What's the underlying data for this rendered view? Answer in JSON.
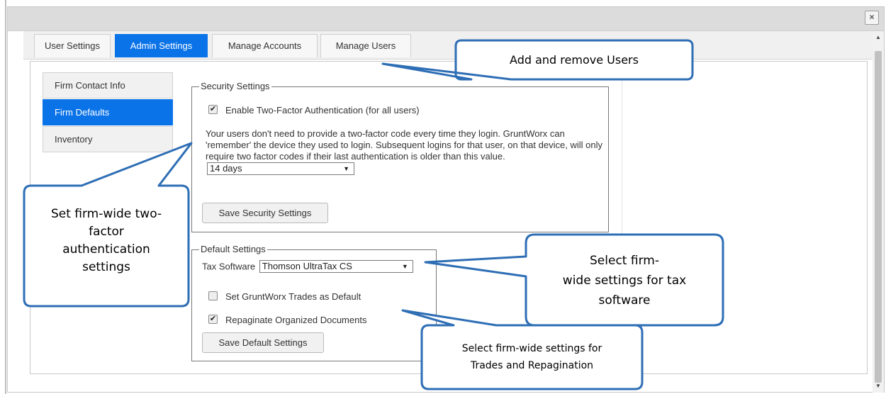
{
  "dialog": {
    "close_label": "×"
  },
  "tabs": [
    {
      "label": "User Settings",
      "active": false
    },
    {
      "label": "Admin Settings",
      "active": true
    },
    {
      "label": "Manage Accounts",
      "active": false
    },
    {
      "label": "Manage Users",
      "active": false
    }
  ],
  "side_nav": [
    {
      "label": "Firm Contact Info",
      "active": false
    },
    {
      "label": "Firm Defaults",
      "active": true
    },
    {
      "label": "Inventory",
      "active": false
    }
  ],
  "security": {
    "legend": "Security Settings",
    "two_factor_label": "Enable Two-Factor Authentication (for all users)",
    "two_factor_checked": true,
    "description": "Your users don't need to provide a two-factor code every time they login. GruntWorx can 'remember' the device they used to login. Subsequent logins for that user, on that device, will only require two factor codes if their last authentication is older than this value.",
    "remember_value": "14 days",
    "save_label": "Save Security Settings"
  },
  "defaults": {
    "legend": "Default Settings",
    "tax_software_label": "Tax Software",
    "tax_software_value": "Thomson UltraTax CS",
    "trades_label": "Set GruntWorx Trades as Default",
    "trades_checked": false,
    "repaginate_label": "Repaginate Organized Documents",
    "repaginate_checked": true,
    "save_label": "Save Default Settings"
  },
  "callouts": {
    "users": "Add and remove Users",
    "two_factor": [
      "Set firm-wide two-",
      "factor",
      "authentication",
      "settings"
    ],
    "tax": [
      "Select firm-",
      "wide settings for tax",
      "software"
    ],
    "trades": [
      "Select firm-wide settings for",
      "Trades and Repagination"
    ]
  },
  "colors": {
    "accent": "#0b73e8",
    "callout_border": "#2e6eb5"
  },
  "icons": {
    "close": "close-icon",
    "scroll_up": "arrow-up-icon",
    "scroll_down": "arrow-down-icon",
    "checkbox": "checkmark-icon",
    "select_caret": "chevron-down-icon"
  }
}
